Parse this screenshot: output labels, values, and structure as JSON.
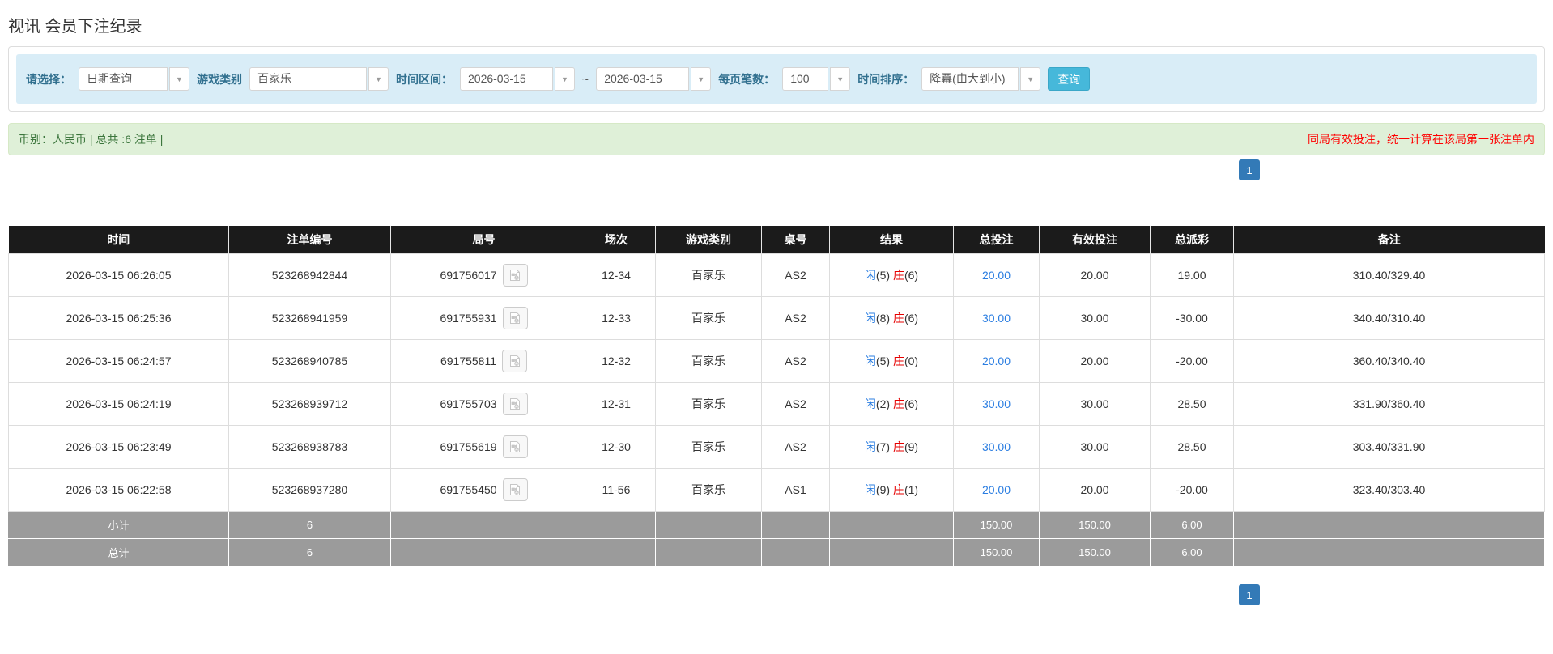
{
  "colors": {
    "accent_blue": "#337ab7",
    "link_blue": "#2a7de1",
    "player_blue": "#2a7de1",
    "banker_red": "#e60000",
    "negative_red": "#e60000",
    "warning_red": "#ff0000",
    "search_button_bg": "#46b8da",
    "filter_bar_bg": "#d9edf7",
    "filter_label_text": "#31708f",
    "success_bar_bg": "#dff0d8",
    "success_bar_text": "#3c763d",
    "table_header_bg": "#1b1b1b",
    "summary_row_bg": "#9b9b9b"
  },
  "page": {
    "title": "视讯 会员下注纪录"
  },
  "filters": {
    "query_type_label": "请选择：",
    "query_type_value": "日期查询",
    "game_type_label": "游戏类别",
    "game_type_value": "百家乐",
    "time_range_label": "时间区间：",
    "date_from": "2026-03-15",
    "range_separator": "~",
    "date_to": "2026-03-15",
    "page_size_label": "每页笔数：",
    "page_size_value": "100",
    "sort_label": "时间排序：",
    "sort_value": "降冪(由大到小)",
    "search_button_label": "查询"
  },
  "summary_bar": {
    "left_text": "币别：人民币 | 总共 :6 注单 |",
    "right_text": "同局有效投注，统一计算在该局第一张注单内"
  },
  "pagination": {
    "current_page": "1"
  },
  "table": {
    "headers": [
      "时间",
      "注单编号",
      "局号",
      "场次",
      "游戏类别",
      "桌号",
      "结果",
      "总投注",
      "有效投注",
      "总派彩",
      "备注"
    ],
    "rows": [
      {
        "time": "2026-03-15 06:26:05",
        "bet_id": "523268942844",
        "round_id": "691756017",
        "session": "12-34",
        "game": "百家乐",
        "table_no": "AS2",
        "result_player": "闲",
        "result_player_num": "(5)",
        "result_banker": "庄",
        "result_banker_num": "(6)",
        "total_bet": "20.00",
        "valid_bet": "20.00",
        "payout": "19.00",
        "remark": "310.40/329.40"
      },
      {
        "time": "2026-03-15 06:25:36",
        "bet_id": "523268941959",
        "round_id": "691755931",
        "session": "12-33",
        "game": "百家乐",
        "table_no": "AS2",
        "result_player": "闲",
        "result_player_num": "(8)",
        "result_banker": "庄",
        "result_banker_num": "(6)",
        "total_bet": "30.00",
        "valid_bet": "30.00",
        "payout": "-30.00",
        "remark": "340.40/310.40"
      },
      {
        "time": "2026-03-15 06:24:57",
        "bet_id": "523268940785",
        "round_id": "691755811",
        "session": "12-32",
        "game": "百家乐",
        "table_no": "AS2",
        "result_player": "闲",
        "result_player_num": "(5)",
        "result_banker": "庄",
        "result_banker_num": "(0)",
        "total_bet": "20.00",
        "valid_bet": "20.00",
        "payout": "-20.00",
        "remark": "360.40/340.40"
      },
      {
        "time": "2026-03-15 06:24:19",
        "bet_id": "523268939712",
        "round_id": "691755703",
        "session": "12-31",
        "game": "百家乐",
        "table_no": "AS2",
        "result_player": "闲",
        "result_player_num": "(2)",
        "result_banker": "庄",
        "result_banker_num": "(6)",
        "total_bet": "30.00",
        "valid_bet": "30.00",
        "payout": "28.50",
        "remark": "331.90/360.40"
      },
      {
        "time": "2026-03-15 06:23:49",
        "bet_id": "523268938783",
        "round_id": "691755619",
        "session": "12-30",
        "game": "百家乐",
        "table_no": "AS2",
        "result_player": "闲",
        "result_player_num": "(7)",
        "result_banker": "庄",
        "result_banker_num": "(9)",
        "total_bet": "30.00",
        "valid_bet": "30.00",
        "payout": "28.50",
        "remark": "303.40/331.90"
      },
      {
        "time": "2026-03-15 06:22:58",
        "bet_id": "523268937280",
        "round_id": "691755450",
        "session": "11-56",
        "game": "百家乐",
        "table_no": "AS1",
        "result_player": "闲",
        "result_player_num": "(9)",
        "result_banker": "庄",
        "result_banker_num": "(1)",
        "total_bet": "20.00",
        "valid_bet": "20.00",
        "payout": "-20.00",
        "remark": "323.40/303.40"
      }
    ],
    "subtotal_row": {
      "label": "小计",
      "bet_count": "6",
      "total_bet": "150.00",
      "valid_bet": "150.00",
      "payout": "6.00"
    },
    "total_row": {
      "label": "总计",
      "bet_count": "6",
      "total_bet": "150.00",
      "valid_bet": "150.00",
      "payout": "6.00"
    }
  }
}
